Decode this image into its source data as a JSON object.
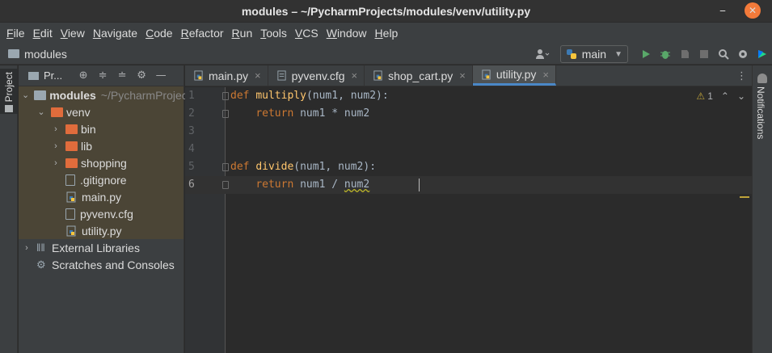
{
  "window": {
    "title": "modules – ~/PycharmProjects/modules/venv/utility.py",
    "minimize_glyph": "⎯",
    "maximize_glyph": "▲",
    "close_glyph": "✕"
  },
  "menu": [
    {
      "mn": "F",
      "rest": "ile"
    },
    {
      "mn": "E",
      "rest": "dit"
    },
    {
      "mn": "V",
      "rest": "iew"
    },
    {
      "mn": "N",
      "rest": "avigate"
    },
    {
      "mn": "C",
      "rest": "ode"
    },
    {
      "mn": "R",
      "rest": "efactor"
    },
    {
      "mn": "R",
      "rest": "un"
    },
    {
      "mn": "T",
      "rest": "ools"
    },
    {
      "mn": "V",
      "rest": "CS"
    },
    {
      "mn": "W",
      "rest": "indow"
    },
    {
      "mn": "H",
      "rest": "elp"
    }
  ],
  "navbar": {
    "breadcrumb": "modules",
    "run_config": "main"
  },
  "project": {
    "label": "Pr...",
    "tree": [
      {
        "name": "modules",
        "hint": "~/PycharmProjec",
        "depth": 0,
        "expanded": true,
        "kind": "folder-grey"
      },
      {
        "name": "venv",
        "depth": 1,
        "expanded": true,
        "kind": "folder-orange"
      },
      {
        "name": "bin",
        "depth": 2,
        "expanded": false,
        "kind": "folder-orange"
      },
      {
        "name": "lib",
        "depth": 2,
        "expanded": false,
        "kind": "folder-orange"
      },
      {
        "name": "shopping",
        "depth": 2,
        "expanded": false,
        "kind": "folder-orange"
      },
      {
        "name": ".gitignore",
        "depth": 2,
        "kind": "file"
      },
      {
        "name": "main.py",
        "depth": 2,
        "kind": "python"
      },
      {
        "name": "pyvenv.cfg",
        "depth": 2,
        "kind": "file"
      },
      {
        "name": "utility.py",
        "depth": 2,
        "kind": "python"
      },
      {
        "name": "External Libraries",
        "depth": 0,
        "expanded": false,
        "kind": "library"
      },
      {
        "name": "Scratches and Consoles",
        "depth": 0,
        "kind": "scratch"
      }
    ]
  },
  "tabs": [
    {
      "label": "main.py",
      "kind": "python",
      "active": false
    },
    {
      "label": "pyvenv.cfg",
      "kind": "file",
      "active": false
    },
    {
      "label": "shop_cart.py",
      "kind": "python",
      "active": false
    },
    {
      "label": "utility.py",
      "kind": "python",
      "active": true
    }
  ],
  "editor": {
    "warning_count": "1",
    "lines": [
      {
        "n": "1",
        "html": "<span class='kw'>def </span><span class='fn'>multiply</span>(num1, num2):",
        "fold": true
      },
      {
        "n": "2",
        "html": "    <span class='kw'>return </span>num1 * num2",
        "fold": true
      },
      {
        "n": "3",
        "html": ""
      },
      {
        "n": "4",
        "html": ""
      },
      {
        "n": "5",
        "html": "<span class='kw'>def </span><span class='fn'>divide</span>(num1, num2):",
        "fold": true
      },
      {
        "n": "6",
        "html": "    <span class='kw'>return </span>num1 / <span class='squig'>num2</span>",
        "fold": true,
        "current": true
      }
    ]
  },
  "right_stripe": {
    "label": "Notifications"
  },
  "left_stripe": {
    "label": "Project"
  },
  "colors": {
    "accent": "#4a88c7",
    "keyword": "#cc7832",
    "function": "#ffc66d",
    "folder_orange": "#e06c3c"
  }
}
